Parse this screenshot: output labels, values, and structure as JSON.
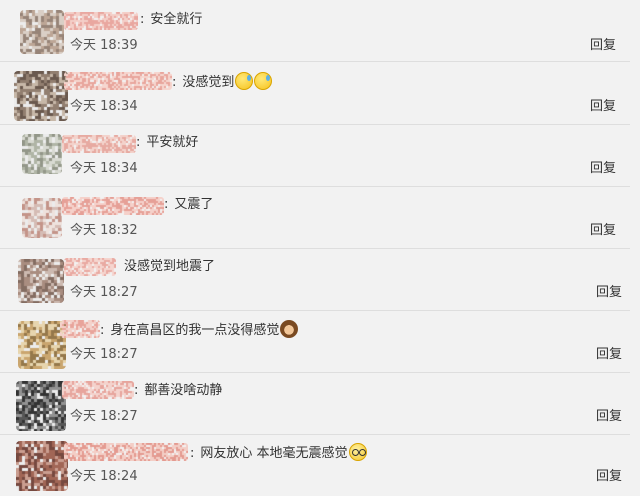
{
  "comments": [
    {
      "text": "安全就行",
      "time": "今天 18:39",
      "reply": "回复",
      "emoji": [],
      "avatar_colors": [
        "#b9a08e",
        "#8f7b6d",
        "#d8ccc2"
      ],
      "nick_colors": [
        "#e9a7a0",
        "#f4cfc8"
      ]
    },
    {
      "text": "没感觉到",
      "time": "今天 18:34",
      "reply": "回复",
      "emoji": [
        "sweat-face-icon",
        "sweat-face-icon"
      ],
      "avatar_colors": [
        "#8a7565",
        "#c4b3a2",
        "#5e4c40"
      ],
      "nick_colors": [
        "#e8a59c",
        "#f6d6cf"
      ]
    },
    {
      "text": "平安就好",
      "time": "今天 18:34",
      "reply": "回复",
      "emoji": [],
      "avatar_colors": [
        "#aab0a0",
        "#8b8f80",
        "#d6d8cf"
      ],
      "nick_colors": [
        "#e7aaa1",
        "#f3d3cc"
      ]
    },
    {
      "text": "又震了",
      "time": "今天 18:32",
      "reply": "回复",
      "emoji": [],
      "avatar_colors": [
        "#d3b8b0",
        "#c08c80",
        "#eee1dc"
      ],
      "nick_colors": [
        "#e6a097",
        "#f5d1ca"
      ]
    },
    {
      "text": "没感觉到地震了",
      "time": "今天 18:27",
      "reply": "回复",
      "emoji": [],
      "avatar_colors": [
        "#7b6256",
        "#a38476",
        "#c9b4aa"
      ],
      "nick_colors": [
        "#e9aaa2",
        "#f5d5cf"
      ]
    },
    {
      "text": "身在高昌区的我一点没得感觉",
      "time": "今天 18:27",
      "reply": "回复",
      "emoji": [
        "see-no-evil-monkey-icon"
      ],
      "avatar_colors": [
        "#c7a064",
        "#8d6d3c",
        "#e6d3a8"
      ],
      "nick_colors": [
        "#e8a49b",
        "#f4d2cb"
      ]
    },
    {
      "text": "鄯善没啥动静",
      "time": "今天 18:27",
      "reply": "回复",
      "emoji": [],
      "avatar_colors": [
        "#222222",
        "#4a4a4a",
        "#8a8a8a"
      ],
      "nick_colors": [
        "#e7a59d",
        "#f4d3cd"
      ]
    },
    {
      "text": "网友放心 本地毫无震感觉",
      "time": "今天 18:24",
      "reply": "回复",
      "emoji": [
        "glasses-face-icon"
      ],
      "avatar_colors": [
        "#6b3a30",
        "#9a5a48",
        "#c79788"
      ],
      "nick_colors": [
        "#e49a90",
        "#f3cec6"
      ]
    }
  ]
}
